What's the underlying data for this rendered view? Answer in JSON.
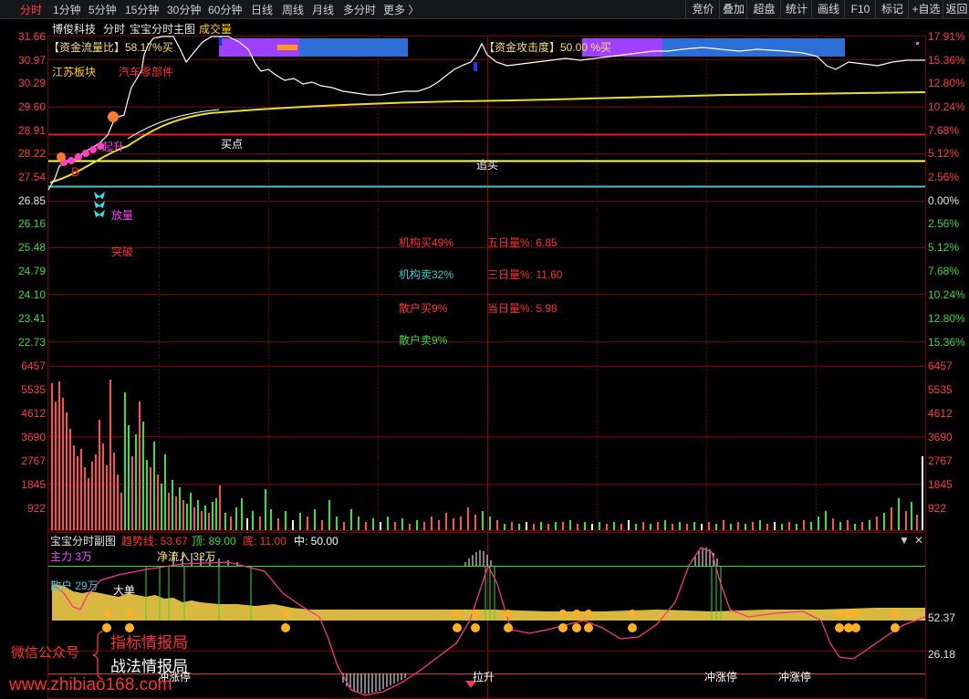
{
  "toolbar": {
    "tabs": [
      "分时",
      "1分钟",
      "5分钟",
      "15分钟",
      "30分钟",
      "60分钟",
      "日线",
      "周线",
      "月线",
      "多分时",
      "更多 〉"
    ],
    "active_tab": "分时",
    "right_buttons": [
      "竞价",
      "叠加",
      "超盘",
      "统计",
      "画线",
      "F10",
      "标记",
      "+自选",
      "返回"
    ]
  },
  "header": {
    "stock_name": "博俊科技",
    "mode": "分时",
    "indicator_name": "宝宝分时主图",
    "volume_label": "成交量"
  },
  "main_chart": {
    "left_axis": [
      "31.66",
      "30.97",
      "30.29",
      "29.60",
      "28.91",
      "28.22",
      "27.54",
      "26.85",
      "26.16",
      "25.48",
      "24.79",
      "24.10",
      "23.41",
      "22.73"
    ],
    "right_axis": [
      "17.91%",
      "15.36%",
      "12.80%",
      "10.24%",
      "7.68%",
      "5.12%",
      "2.56%",
      "0.00%",
      "2.56%",
      "5.12%",
      "7.68%",
      "10.24%",
      "12.80%",
      "15.36%"
    ],
    "flow_box_1": "【资金流量比】58.17%买",
    "flow_box_2": "【资金攻击度】50.00 %买",
    "tag_sector": "江苏板块",
    "tag_concept": "汽车零部件",
    "tag_buy_point": "买点",
    "tag_chase": "追买",
    "tag_volume": "放量",
    "tag_breakout": "突破",
    "tag_up": "起升",
    "stats": {
      "inst_buy": "机构买49%",
      "inst_sell": "机构卖32%",
      "retail_buy": "散户买9%",
      "retail_sell": "散户卖9%",
      "five_day": "五日量%: 6.85",
      "three_day": "三日量%: 11.60",
      "today": "当日量%: 5.98"
    }
  },
  "volume_chart": {
    "axis": [
      "6457",
      "5535",
      "4612",
      "3690",
      "2767",
      "1845",
      "922"
    ]
  },
  "sub_chart": {
    "title": "宝宝分时副图",
    "trend": "趋势线: 53.67",
    "top": "顶: 89.00",
    "bottom": "底: 11.00",
    "mid": "中: 50.00",
    "main_force": "主力 3万",
    "net_inflow": "净流入 32万",
    "retail": "散户 29万",
    "big_order": "大单",
    "pull_up": "拉升",
    "limit_up_1": "冲涨停",
    "limit_up_2": "冲涨停",
    "limit_up_3": "冲涨停",
    "right_axis": [
      "52.37",
      "26.18"
    ],
    "controls": [
      "▼",
      "✕"
    ]
  },
  "watermark": {
    "wechat": "微信公众号",
    "line1": "指标情报局",
    "line2": "战法情报局",
    "url": "www.zhibiao168.com"
  },
  "colors": {
    "price_up": "#ff3b3b",
    "price_down": "#3bd23b",
    "avg_line": "#ffff33",
    "grid": "#7a0000"
  }
}
